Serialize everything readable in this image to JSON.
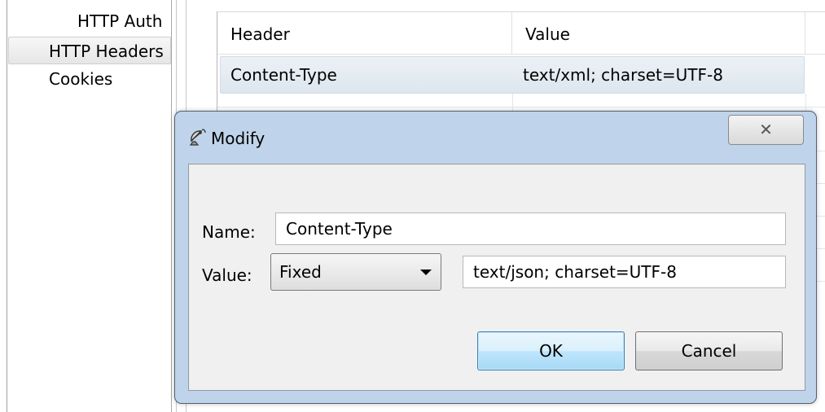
{
  "nav": {
    "items": [
      {
        "label": "HTTP Auth"
      },
      {
        "label": "HTTP Headers"
      },
      {
        "label": "Cookies"
      }
    ]
  },
  "table": {
    "columns": [
      "Header",
      "Value"
    ],
    "rows": [
      {
        "header": "Content-Type",
        "value": "text/xml; charset=UTF-8"
      }
    ]
  },
  "dialog": {
    "title": "Modify",
    "close_glyph": "✕",
    "name_label": "Name:",
    "name_value": "Content-Type",
    "value_label": "Value:",
    "value_mode": "Fixed",
    "value_text": "text/json; charset=UTF-8",
    "ok_label": "OK",
    "cancel_label": "Cancel"
  }
}
